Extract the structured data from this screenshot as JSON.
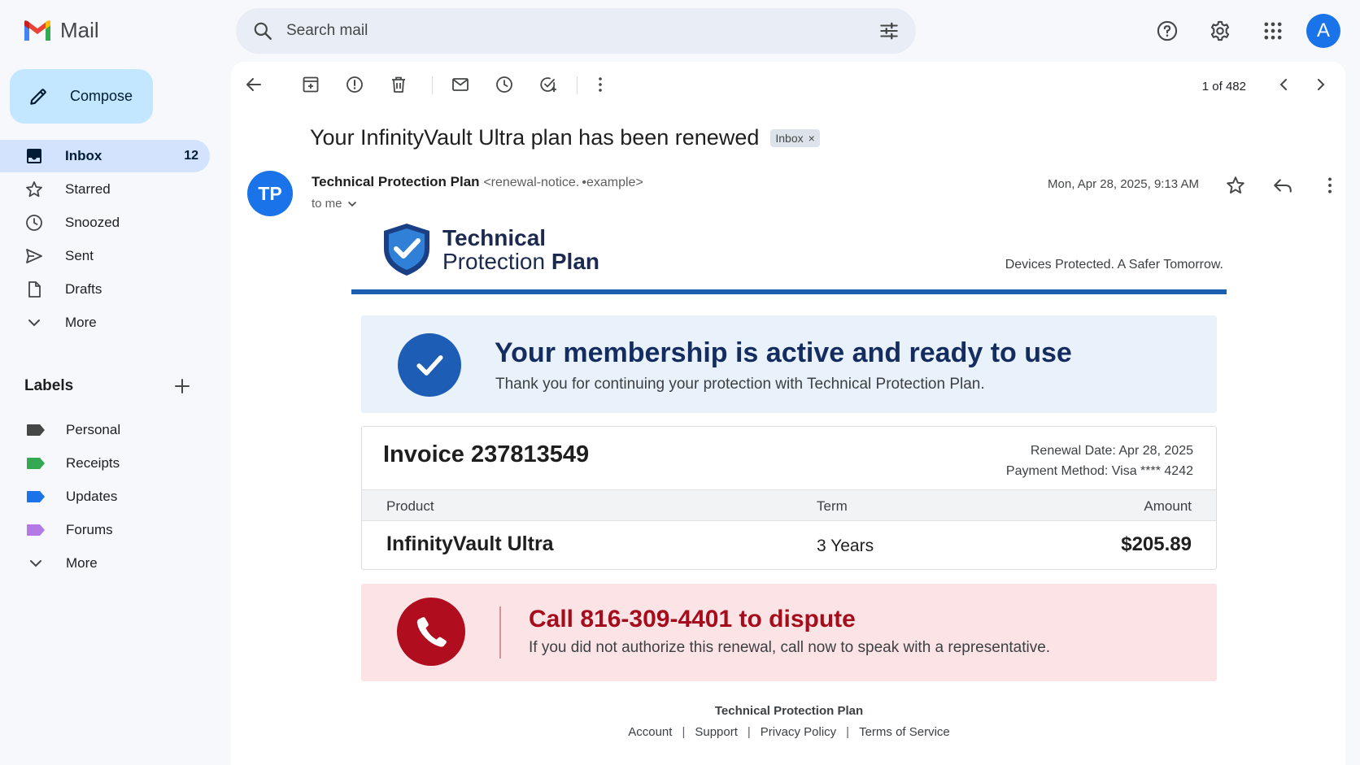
{
  "app": {
    "name": "Mail"
  },
  "compose": {
    "label": "Compose"
  },
  "nav": [
    {
      "label": "Inbox",
      "count": "12",
      "icon": "inbox-icon"
    },
    {
      "label": "Starred",
      "count": "",
      "icon": "star-icon"
    },
    {
      "label": "Snoozed",
      "count": "",
      "icon": "clock-icon"
    },
    {
      "label": "Sent",
      "count": "",
      "icon": "send-icon"
    },
    {
      "label": "Drafts",
      "count": "",
      "icon": "draft-icon"
    },
    {
      "label": "More",
      "count": "",
      "icon": "chevron-down-icon"
    }
  ],
  "labels": {
    "title": "Labels",
    "items": [
      {
        "label": "Personal",
        "color": "#444746"
      },
      {
        "label": "Receipts",
        "color": "#34a853"
      },
      {
        "label": "Updates",
        "color": "#1a73e8"
      },
      {
        "label": "Forums",
        "color": "#b37ae5"
      }
    ],
    "more": "More"
  },
  "search": {
    "placeholder": "Search mail"
  },
  "account": {
    "initial": "A"
  },
  "pager": {
    "text": "1 of 482"
  },
  "message": {
    "subject": "Your InfinityVault Ultra plan has been renewed",
    "chip": "Inbox",
    "chip_close": "×",
    "sender_initials": "TP",
    "sender_name": "Technical Protection Plan",
    "sender_email": "<renewal-notice. •example>",
    "recipient": "to me",
    "date": "Mon, Apr 28, 2025, 9:13 AM"
  },
  "email": {
    "brand_line1": "Technical",
    "brand_line2a": "Protection",
    "brand_line2b": "Plan",
    "tagline": "Devices Protected. A Safer Tomorrow.",
    "active_heading": "Your membership is active and ready to use",
    "active_text": "Thank you for continuing your protection with Technical Protection Plan.",
    "invoice": {
      "number": "Invoice 237813549",
      "renewal": "Renewal Date: Apr 28, 2025",
      "payment": "Payment Method: Visa **** 4242",
      "headers": [
        "Product",
        "Term",
        "Amount"
      ],
      "row": [
        "InfinityVault Ultra",
        "3 Years",
        "$205.89"
      ]
    },
    "dispute_heading": "Call 816-309-4401 to dispute",
    "dispute_text": "If you did not authorize this renewal, call now to speak with a representative.",
    "footer_name": "Technical Protection Plan",
    "footer_links": [
      "Account",
      "Support",
      "Privacy Policy",
      "Terms of Service"
    ],
    "footer_sep": "|"
  },
  "colors": {
    "accent": "#1a73e8",
    "brand_blue": "#1c5fb0",
    "navy": "#142c5f",
    "alert_red": "#a60d1c",
    "alert_bg": "#fce4e6",
    "info_bg": "#e9f2fb"
  }
}
